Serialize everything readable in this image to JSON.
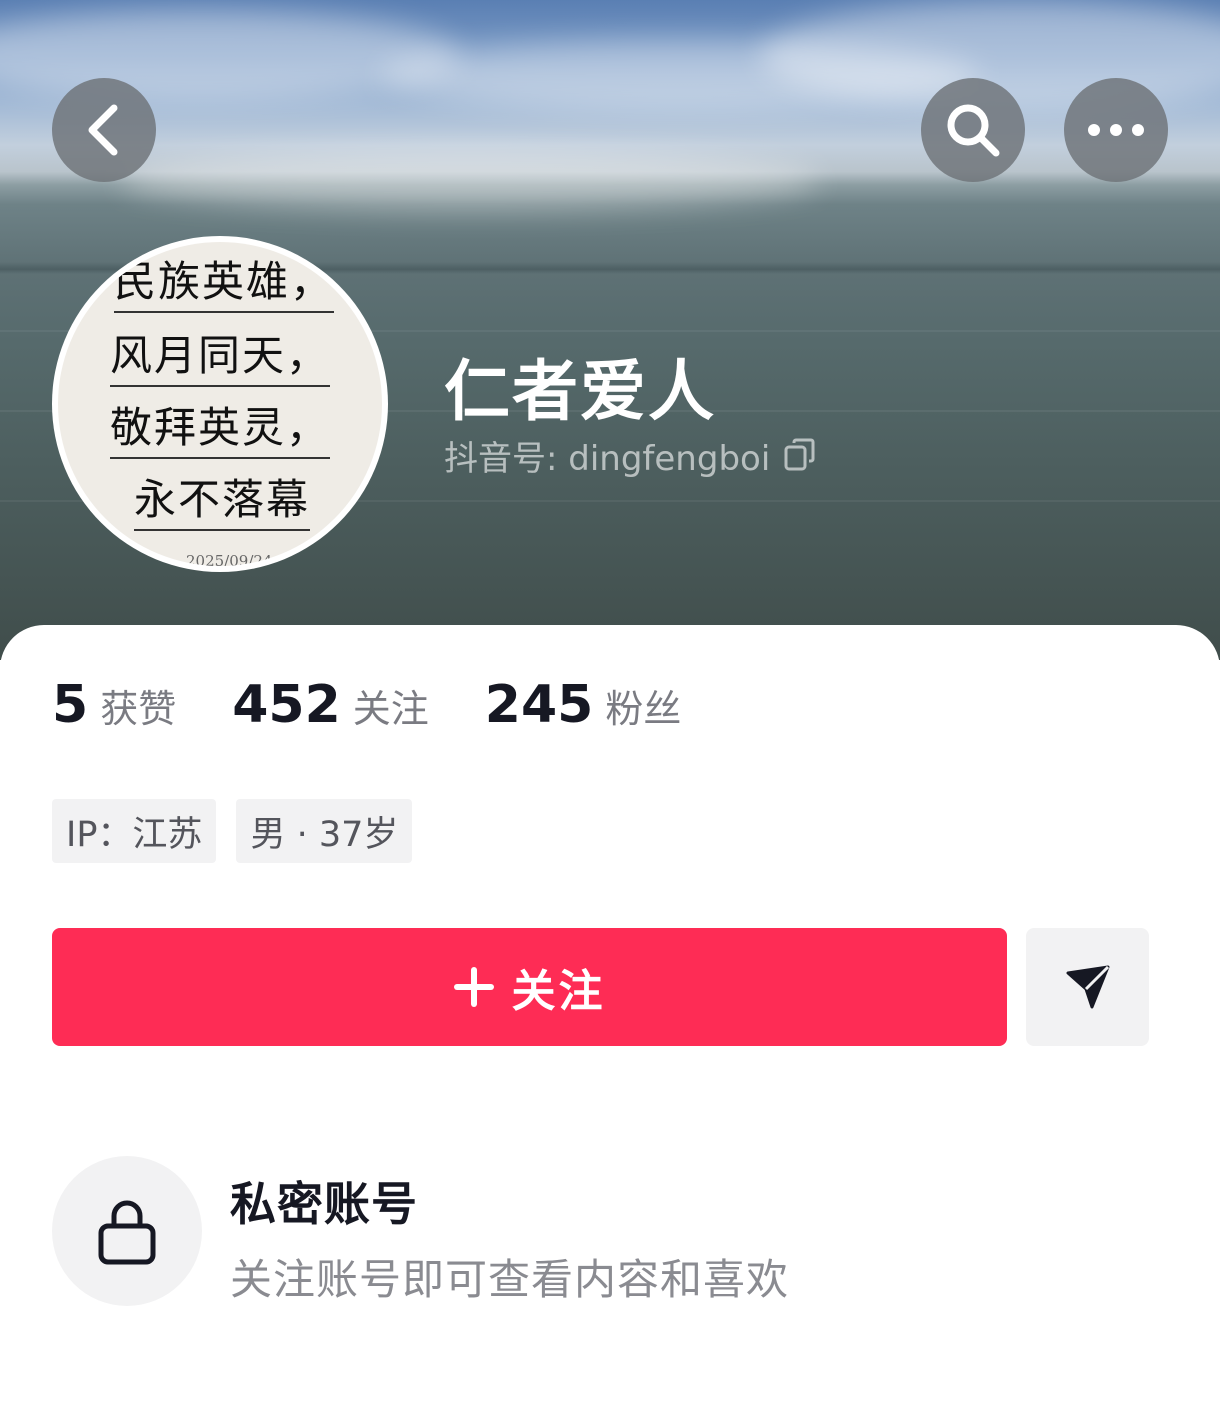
{
  "header": {
    "back_icon": "chevron-left-icon",
    "search_icon": "search-icon",
    "more_icon": "more-horizontal-icon"
  },
  "profile": {
    "avatar_poem": [
      "民族英雄，",
      "风月同天，",
      "敬拜英灵，",
      "永不落幕"
    ],
    "avatar_date": "2025/09/24",
    "nickname": "仁者爱人",
    "account_id_label": "抖音号: dingfengboi",
    "copy_icon": "copy-icon"
  },
  "stats": [
    {
      "value": "5",
      "label": "获赞"
    },
    {
      "value": "452",
      "label": "关注"
    },
    {
      "value": "245",
      "label": "粉丝"
    }
  ],
  "tags": [
    "IP：江苏",
    "男 · 37岁"
  ],
  "actions": {
    "follow_label": "关注",
    "follow_icon": "plus-icon",
    "share_icon": "send-icon",
    "accent_color": "#fe2c55"
  },
  "private_notice": {
    "icon": "lock-icon",
    "title": "私密账号",
    "description": "关注账号即可查看内容和喜欢"
  }
}
